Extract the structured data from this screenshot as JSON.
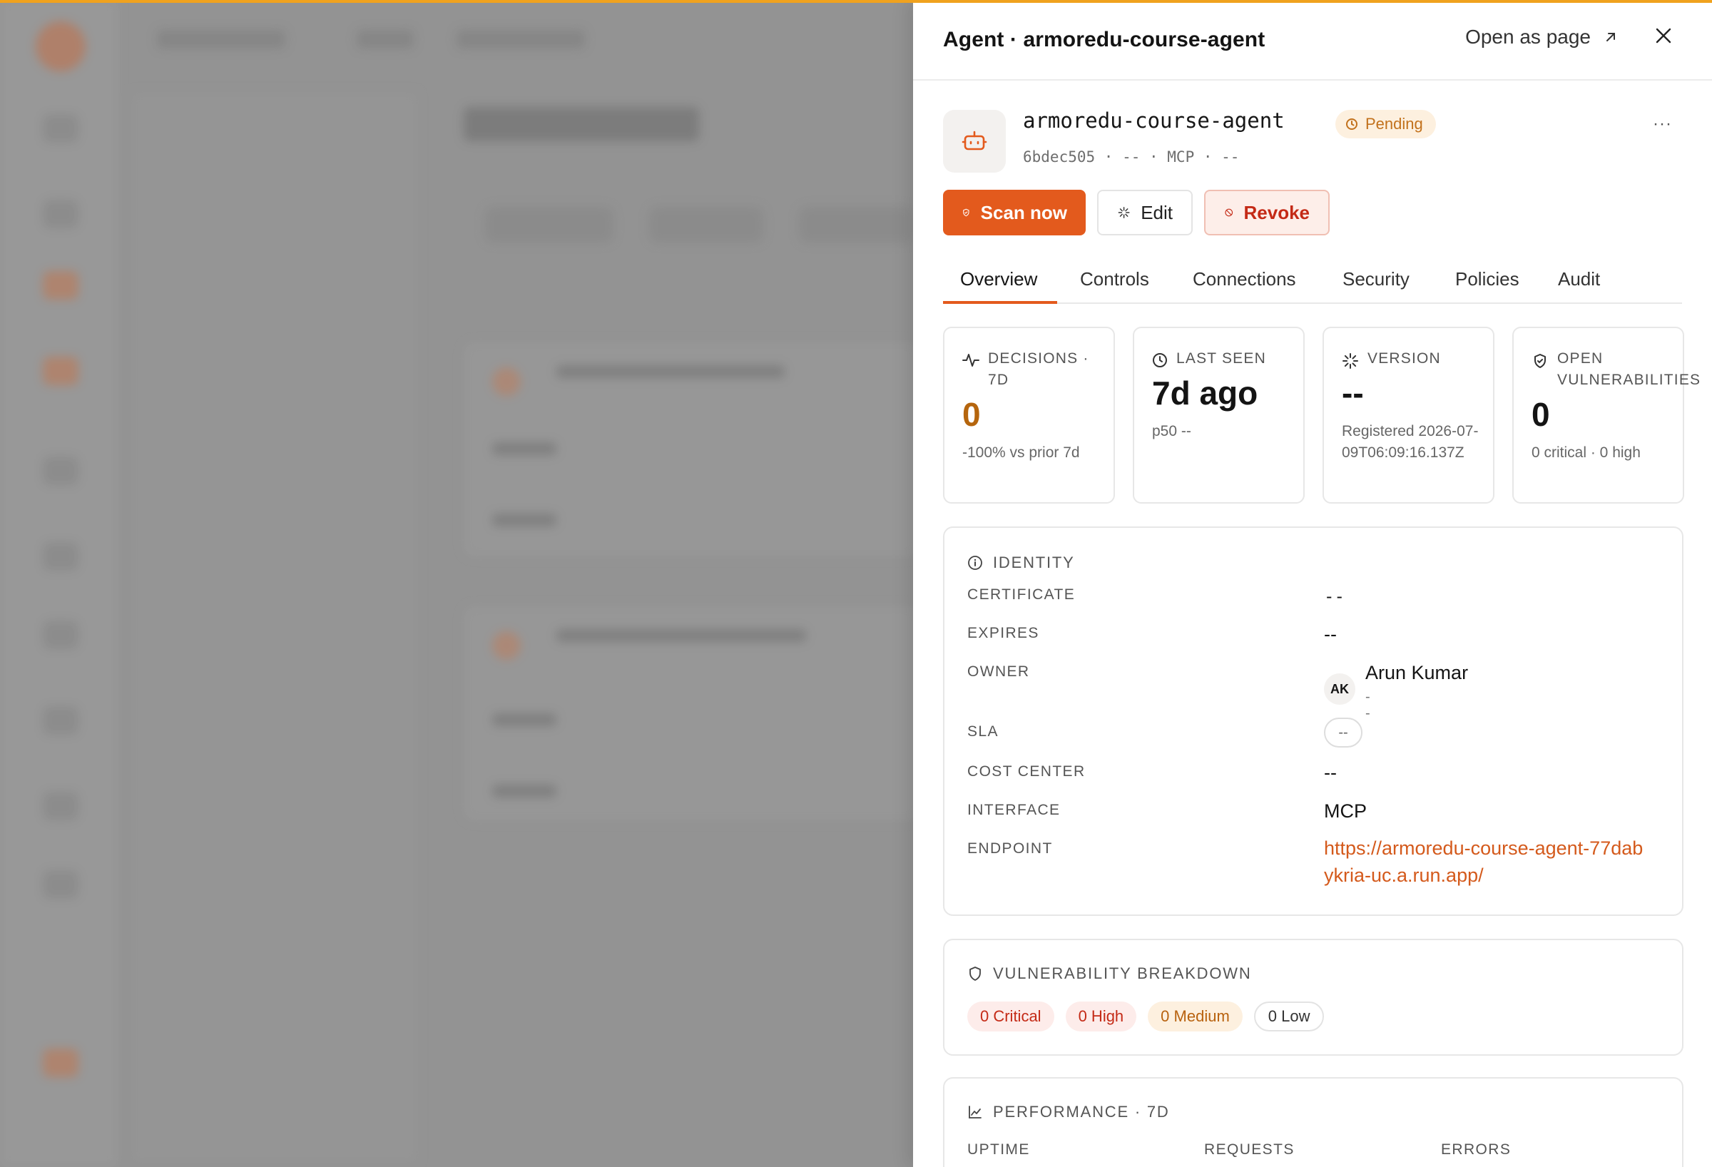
{
  "drawer": {
    "title": "Agent · armoredu-course-agent",
    "open_as_page": "Open as page",
    "agent": {
      "name": "armoredu-course-agent",
      "status": "Pending",
      "meta": "6bdec505 · -- · MCP · --"
    },
    "actions": {
      "scan": "Scan now",
      "edit": "Edit",
      "revoke": "Revoke"
    },
    "tabs": [
      "Overview",
      "Controls",
      "Connections",
      "Security",
      "Policies",
      "Audit"
    ],
    "active_tab": "Overview",
    "stats": [
      {
        "label": "DECISIONS · 7D",
        "value": "0",
        "sub": "-100% vs prior 7d",
        "icon": "activity-icon"
      },
      {
        "label": "LAST SEEN",
        "value": "7d ago",
        "sub": "p50 --",
        "icon": "clock-icon"
      },
      {
        "label": "VERSION",
        "value": "--",
        "sub": "Registered 2026-07-09T06:09:16.137Z",
        "icon": "loader-icon"
      },
      {
        "label": "OPEN VULNERABILITIES",
        "value": "0",
        "sub": "0 critical · 0 high",
        "icon": "shield-check-icon"
      }
    ],
    "identity": {
      "title": "IDENTITY",
      "certificate_label": "CERTIFICATE",
      "certificate_value": "--",
      "expires_label": "EXPIRES",
      "expires_value": "--",
      "owner_label": "OWNER",
      "owner_initials": "AK",
      "owner_name": "Arun Kumar",
      "owner_sub": "--",
      "sla_label": "SLA",
      "sla_value": "--",
      "cost_center_label": "COST CENTER",
      "cost_center_value": "--",
      "interface_label": "INTERFACE",
      "interface_value": "MCP",
      "endpoint_label": "ENDPOINT",
      "endpoint_value": "https://armoredu-course-agent-77dabykria-uc.a.run.app/"
    },
    "vulnerability": {
      "title": "VULNERABILITY BREAKDOWN",
      "critical": "0 Critical",
      "high": "0 High",
      "medium": "0 Medium",
      "low": "0 Low"
    },
    "performance": {
      "title": "PERFORMANCE · 7D",
      "uptime_label": "UPTIME",
      "requests_label": "REQUESTS",
      "errors_label": "ERRORS"
    }
  },
  "colors": {
    "accent": "#e35a1d",
    "pending": "#c2711c",
    "danger": "#c42a16",
    "top_bar": "#f0a21e"
  }
}
